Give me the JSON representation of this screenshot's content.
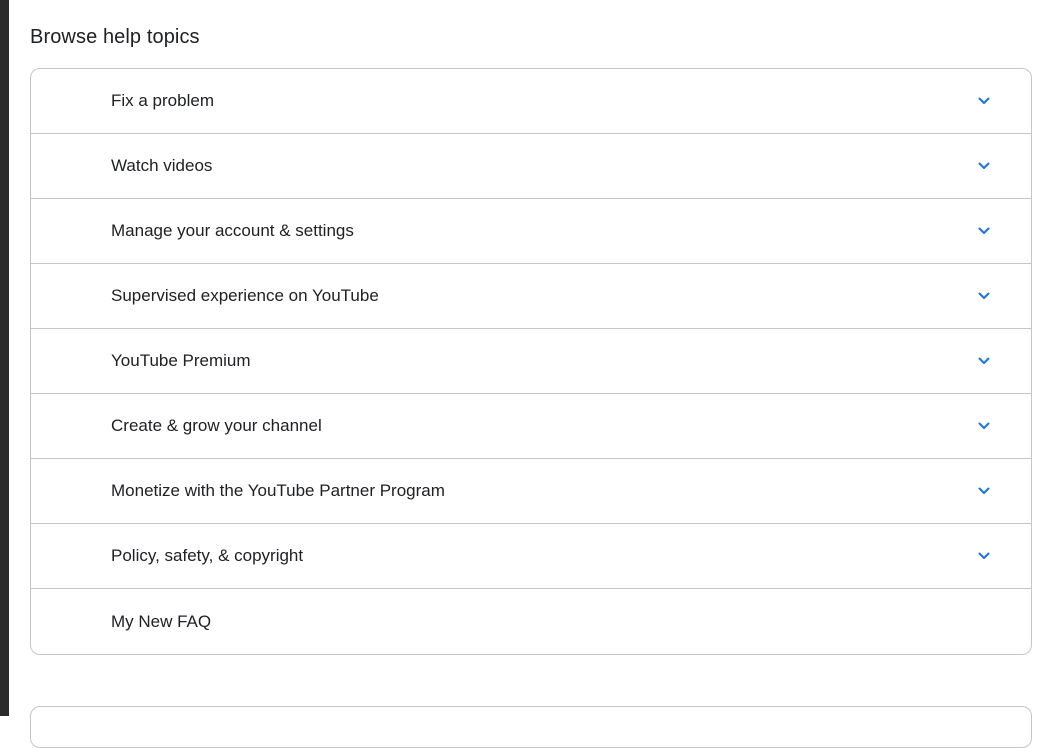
{
  "section": {
    "title": "Browse help topics"
  },
  "topics": [
    {
      "label": "Fix a problem",
      "expandable": true
    },
    {
      "label": "Watch videos",
      "expandable": true
    },
    {
      "label": "Manage your account & settings",
      "expandable": true
    },
    {
      "label": "Supervised experience on YouTube",
      "expandable": true
    },
    {
      "label": "YouTube Premium",
      "expandable": true
    },
    {
      "label": "Create & grow your channel",
      "expandable": true
    },
    {
      "label": "Monetize with the YouTube Partner Program",
      "expandable": true
    },
    {
      "label": "Policy, safety, & copyright",
      "expandable": true
    },
    {
      "label": "My New FAQ",
      "expandable": false
    }
  ],
  "icons": {
    "expand": "chevron-down-icon"
  },
  "colors": {
    "accent": "#1a73e8",
    "border": "#c6c6c6",
    "text": "#202124"
  }
}
